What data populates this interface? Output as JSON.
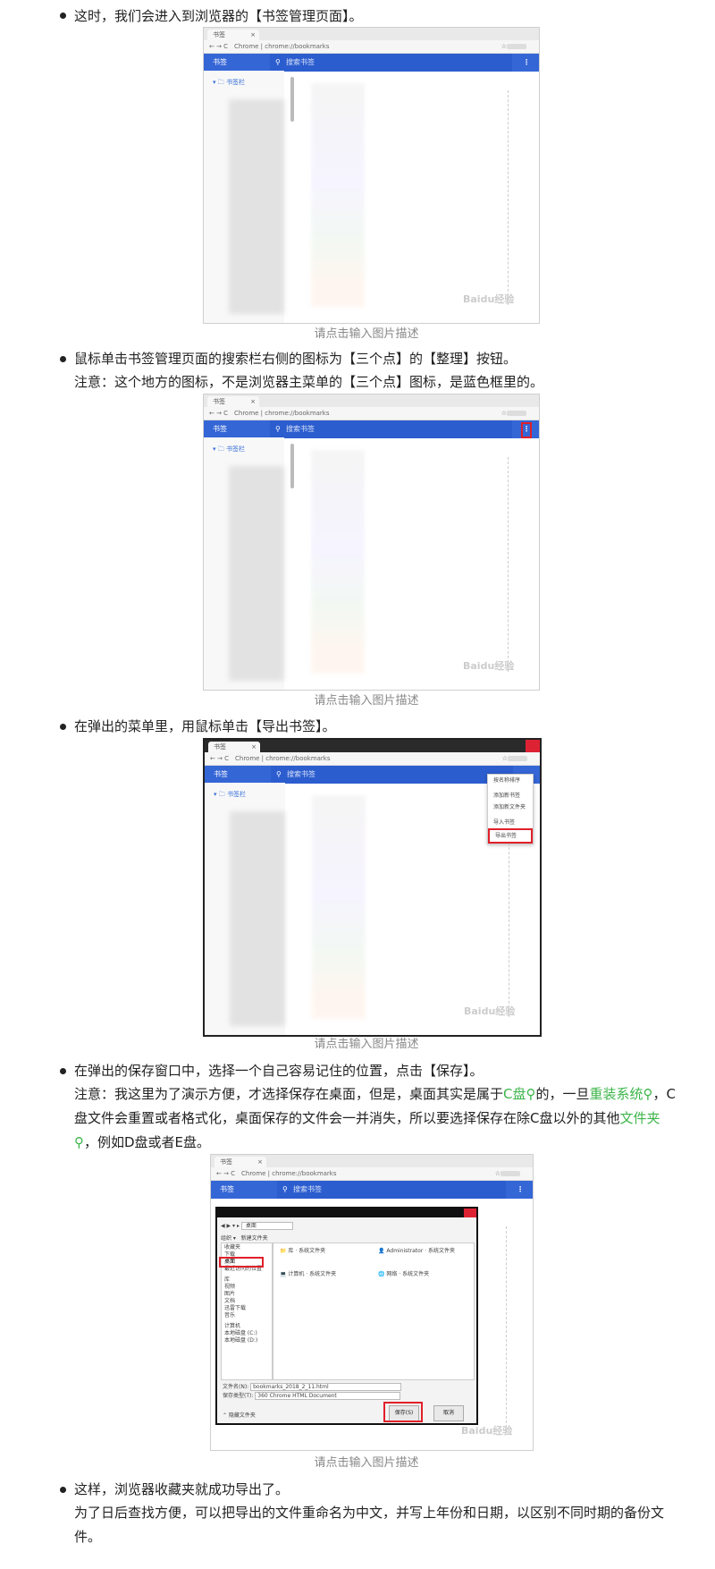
{
  "steps": [
    {
      "lines": [
        "这时，我们会进入到浏览器的【书签管理页面】。"
      ],
      "caption": "请点击输入图片描述"
    },
    {
      "lines": [
        "鼠标单击书签管理页面的搜索栏右侧的图标为【三个点】的【整理】按钮。",
        "注意：这个地方的图标，不是浏览器主菜单的【三个点】图标，是蓝色框里的。"
      ],
      "caption": "请点击输入图片描述"
    },
    {
      "lines": [
        "在弹出的菜单里，用鼠标单击【导出书签】。"
      ],
      "caption": "请点击输入图片描述"
    },
    {
      "line1": "在弹出的保存窗口中，选择一个自己容易记住的位置，点击【保存】。",
      "note_a": "注意：我这里为了演示方便，才选择保存在桌面，但是，桌面其实是属于",
      "link_c": "C盘",
      "note_b": "的，一旦",
      "link_reinstall": "重装系统",
      "note_c": "，C盘文件会重置或者格式化，桌面保存的文件会一并消失，所以要选择保存在除C盘以外的其他",
      "link_folder": "文件夹",
      "note_d": "，例如D盘或者E盘。",
      "caption": "请点击输入图片描述"
    },
    {
      "lines": [
        "这样，浏览器收藏夹就成功导出了。",
        "为了日后查找方便，可以把导出的文件重命名为中文，并写上年份和日期，以区别不同时期的备份文件。"
      ]
    }
  ],
  "browser": {
    "tab_label": "书签",
    "tab_close": "×",
    "nav": "← → C",
    "url": "Chrome | chrome://bookmarks",
    "star": "☆",
    "header_title": "书签",
    "search_placeholder": "搜索书签",
    "search_icon": "search-icon",
    "more_dots": "⋮",
    "folder_label": "书签栏",
    "watermark": "Baidu经验"
  },
  "menu": {
    "items": [
      "按名称排序",
      "添加新书签",
      "添加新文件夹",
      "导入书签",
      "导出书签"
    ]
  },
  "save_dialog": {
    "address": "桌面",
    "organize": "组织 ▾",
    "new_folder": "新建文件夹",
    "sidebar": [
      "收藏夹",
      "下载",
      "桌面",
      "最近访问的位置",
      "库",
      "视频",
      "图片",
      "文档",
      "迅雷下载",
      "音乐",
      "计算机",
      "本地磁盘 (C:)",
      "本地磁盘 (D:)"
    ],
    "files": [
      {
        "name": "库",
        "type": "系统文件夹"
      },
      {
        "name": "Administrator",
        "type": "系统文件夹"
      },
      {
        "name": "计算机",
        "type": "系统文件夹"
      },
      {
        "name": "网络",
        "type": "系统文件夹"
      }
    ],
    "filename_label": "文件名(N):",
    "filename_value": "bookmarks_2018_2_11.html",
    "filetype_label": "保存类型(T):",
    "filetype_value": "360 Chrome HTML Document",
    "hide_folders": "⌃ 隐藏文件夹",
    "save_button": "保存(S)",
    "cancel_button": "取消"
  },
  "colors": {
    "accent_blue": "#3566d6",
    "highlight_red": "#e0202a",
    "link_green": "#3db54a"
  }
}
